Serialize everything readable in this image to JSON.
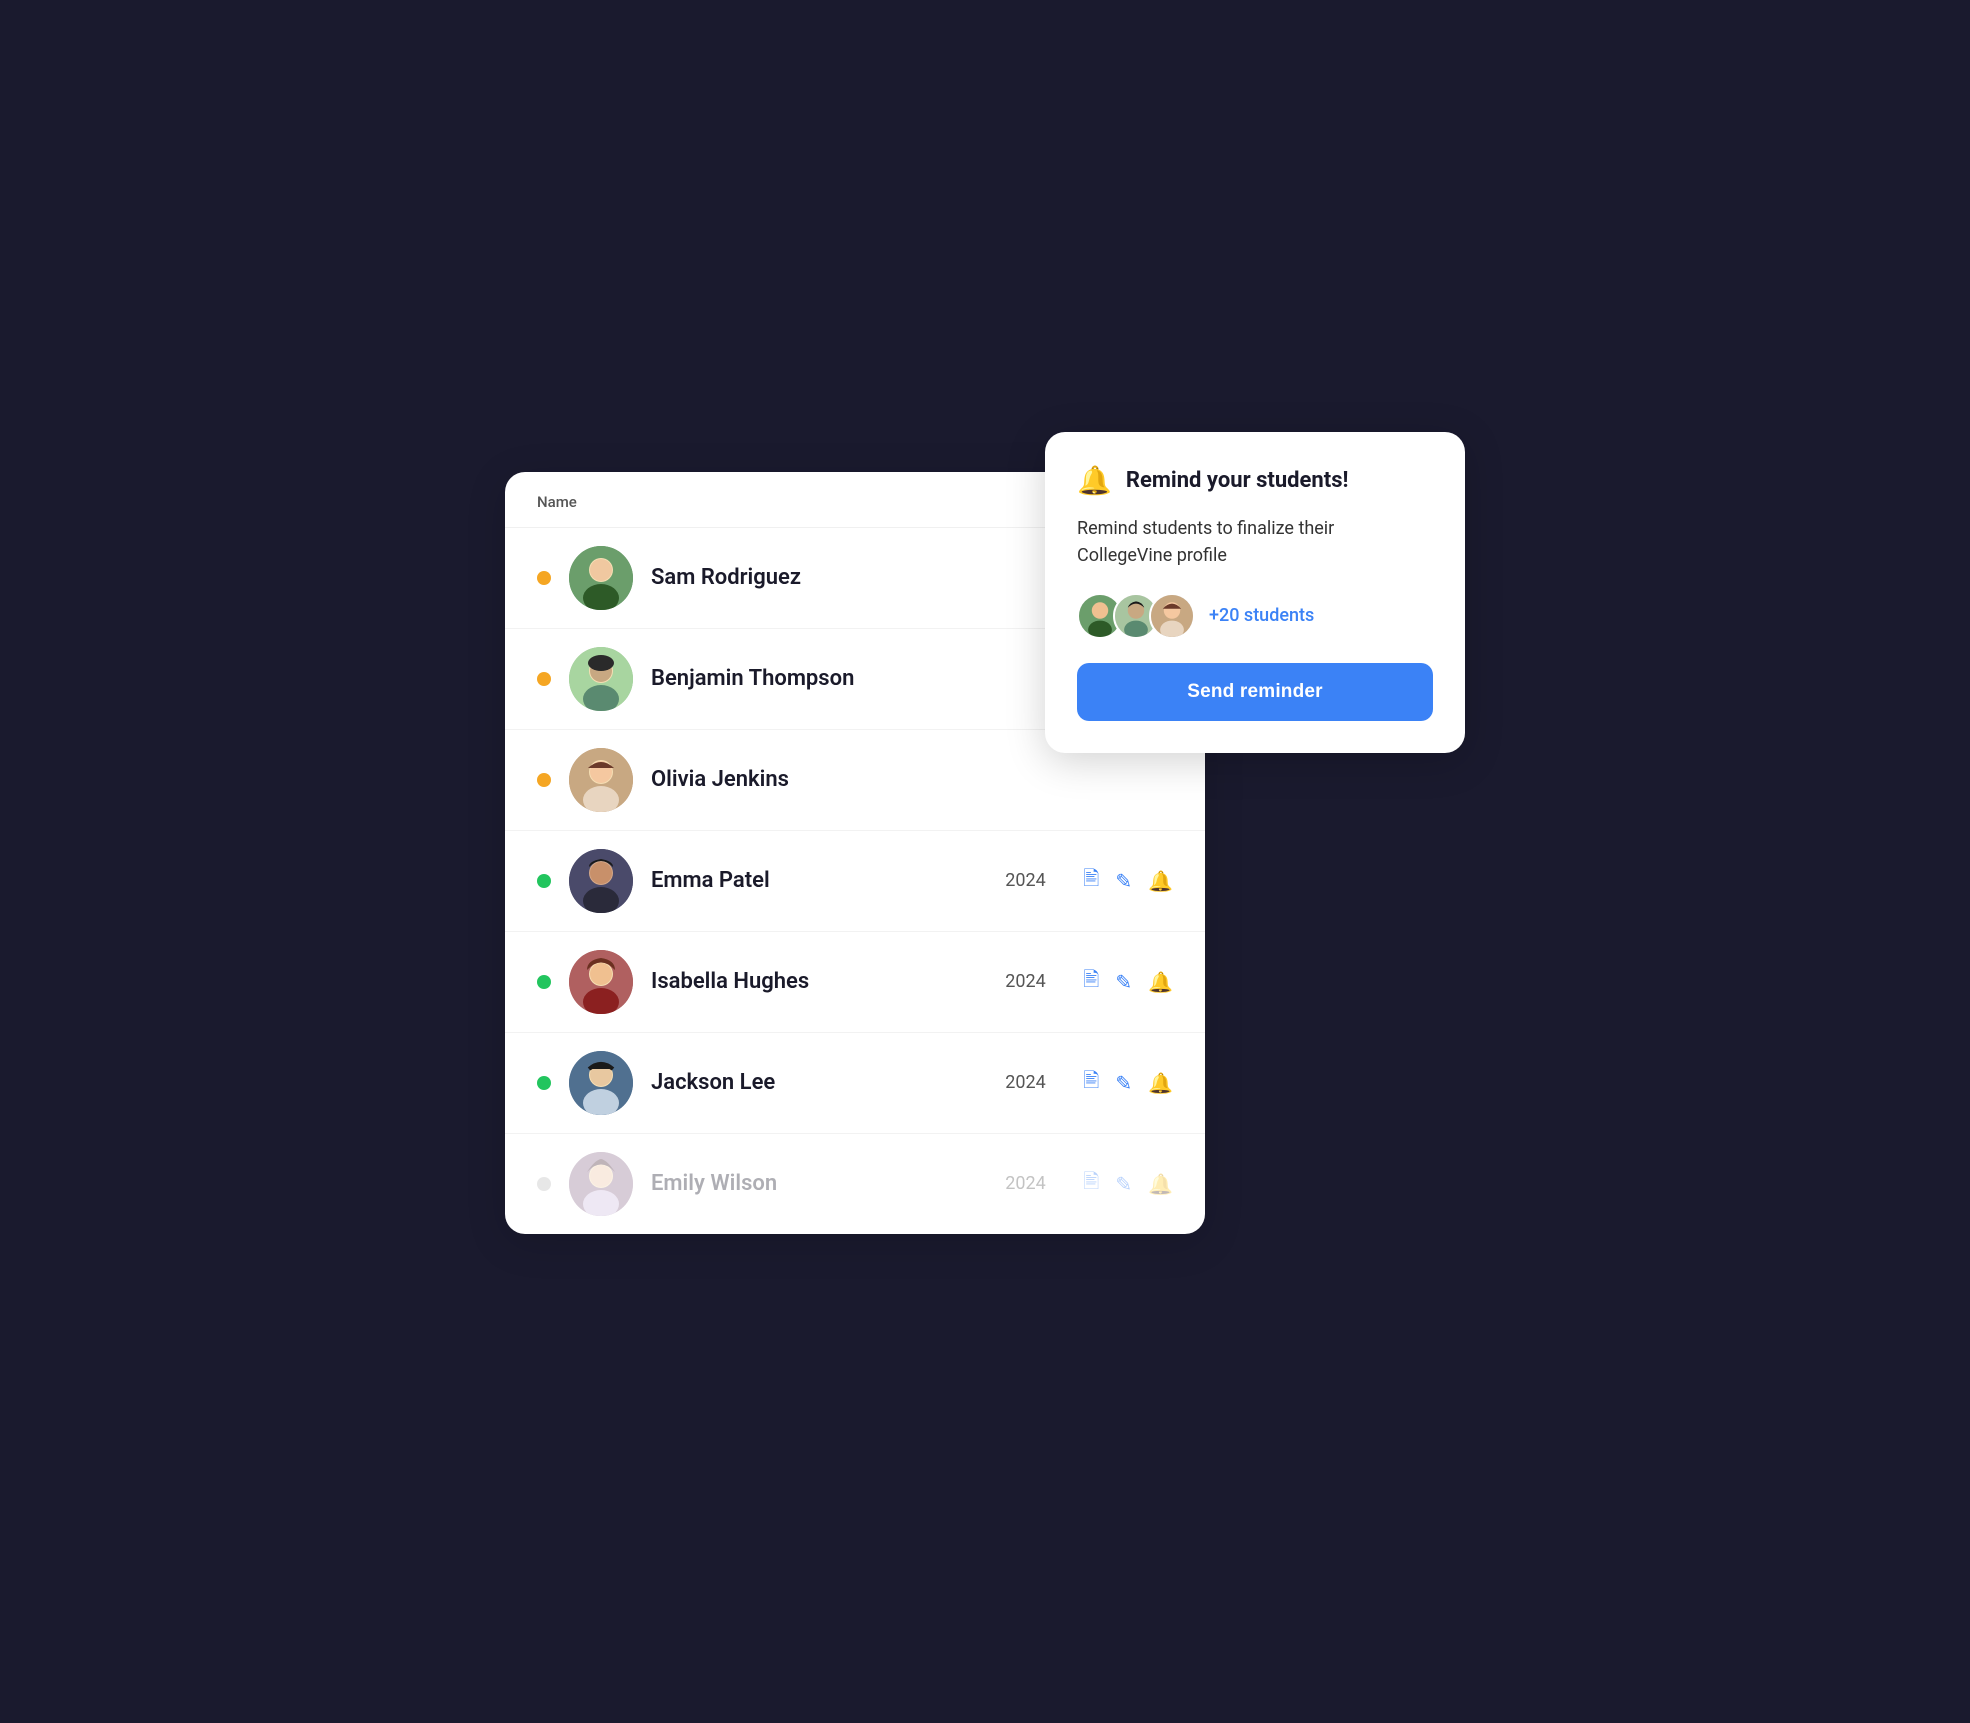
{
  "colors": {
    "accent_blue": "#3b82f6",
    "status_yellow": "#f5a623",
    "status_green": "#22c55e",
    "status_gray": "#bbb"
  },
  "table": {
    "column_name_label": "Name",
    "students": [
      {
        "id": "sam-rodriguez",
        "name": "Sam Rodriguez",
        "status": "yellow",
        "grad_year": "",
        "has_actions": false,
        "avatar_class": "av1"
      },
      {
        "id": "benjamin-thompson",
        "name": "Benjamin Thompson",
        "status": "yellow",
        "grad_year": "",
        "has_actions": false,
        "avatar_class": "av2"
      },
      {
        "id": "olivia-jenkins",
        "name": "Olivia Jenkins",
        "status": "yellow",
        "grad_year": "",
        "has_actions": false,
        "avatar_class": "av3"
      },
      {
        "id": "emma-patel",
        "name": "Emma Patel",
        "status": "green",
        "grad_year": "2024",
        "has_actions": true,
        "avatar_class": "av4"
      },
      {
        "id": "isabella-hughes",
        "name": "Isabella Hughes",
        "status": "green",
        "grad_year": "2024",
        "has_actions": true,
        "avatar_class": "av5"
      },
      {
        "id": "jackson-lee",
        "name": "Jackson Lee",
        "status": "green",
        "grad_year": "2024",
        "has_actions": true,
        "avatar_class": "av6"
      },
      {
        "id": "emily-wilson",
        "name": "Emily Wilson",
        "status": "gray",
        "grad_year": "2024",
        "has_actions": true,
        "avatar_class": "av7"
      }
    ]
  },
  "reminder_popup": {
    "title": "Remind your students!",
    "description": "Remind students to finalize their CollegeVine profile",
    "students_count_label": "+20 students",
    "send_button_label": "Send reminder"
  }
}
